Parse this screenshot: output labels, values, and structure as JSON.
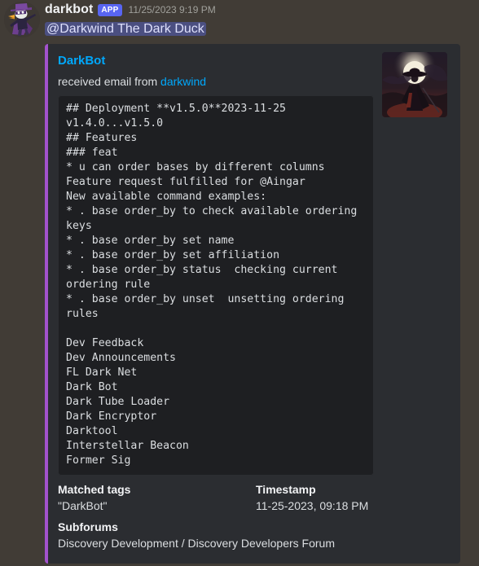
{
  "message": {
    "author": "darkbot",
    "bot_badge": "APP",
    "timestamp": "11/25/2023 9:19 PM",
    "mention": "@Darkwind The Dark Duck",
    "avatar_icon": "darkwing-duck-avatar"
  },
  "embed": {
    "accent_color": "#a352cd",
    "author": "DarkBot",
    "description_prefix": "received email from ",
    "description_link": "darkwind",
    "thumbnail_icon": "caped-figure-moon-thumbnail",
    "code_block": "## Deployment **v1.5.0**2023-11-25\nv1.4.0...v1.5.0\n## Features\n### feat\n* u can order bases by different columns\nFeature request fulfilled for @Aingar\nNew available command examples:\n* . base order_by to check available ordering keys\n* . base order_by set name\n* . base order_by set affiliation\n* . base order_by status  checking current ordering rule\n* . base order_by unset  unsetting ordering rules\n\nDev Feedback\nDev Announcements\nFL Dark Net\nDark Bot\nDark Tube Loader\nDark Encryptor\nDarktool\nInterstellar Beacon\nFormer Sig",
    "fields": [
      {
        "name": "Matched tags",
        "value": "\"DarkBot\""
      },
      {
        "name": "Timestamp",
        "value": "11-25-2023, 09:18 PM"
      },
      {
        "name": "Subforums",
        "value": "Discovery Development / Discovery Developers Forum"
      }
    ]
  }
}
